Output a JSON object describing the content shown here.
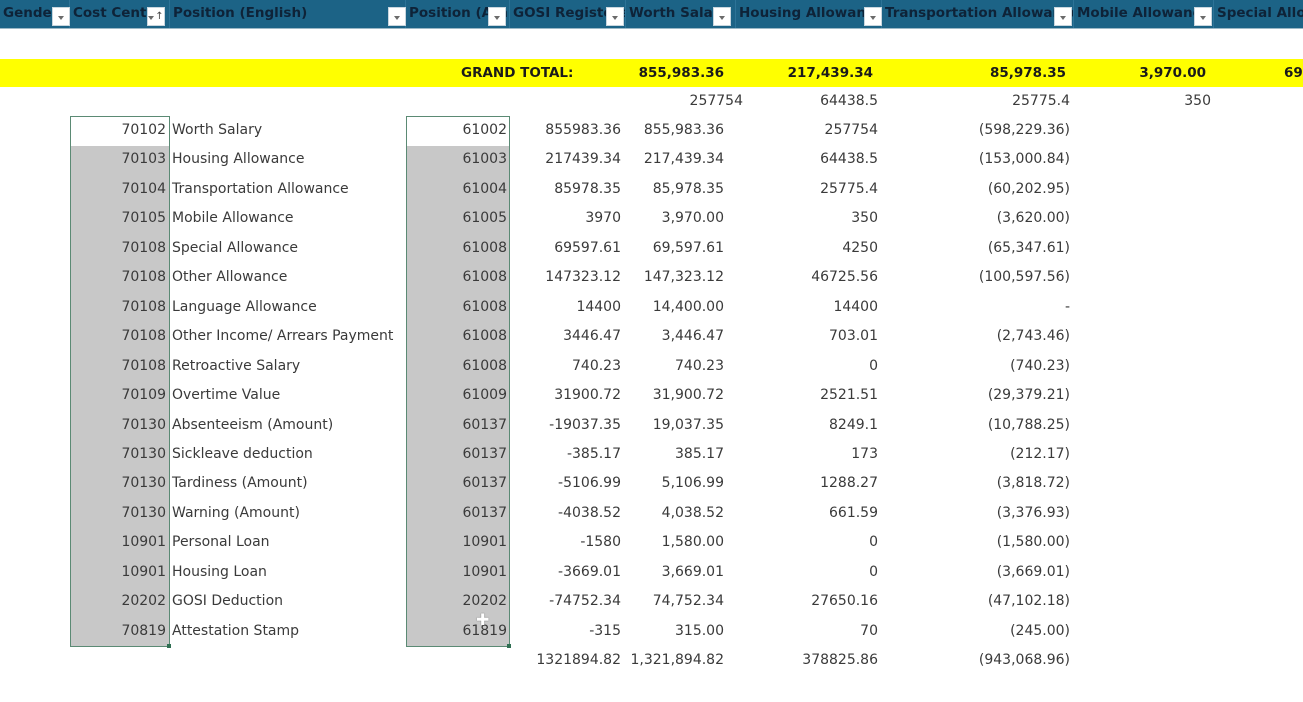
{
  "header": {
    "columns": [
      {
        "label": "Gender",
        "filter": "dropdown"
      },
      {
        "label": "Cost Center",
        "filter": "sorted-ascending"
      },
      {
        "label": "Position (English)",
        "filter": "dropdown"
      },
      {
        "label": "Position (Arabic)",
        "filter": "dropdown"
      },
      {
        "label": "GOSI Registered",
        "filter": "dropdown"
      },
      {
        "label": "Worth Salary",
        "filter": "dropdown"
      },
      {
        "label": "Housing Allowance",
        "filter": "dropdown"
      },
      {
        "label": "Transportation Allowance",
        "filter": "dropdown"
      },
      {
        "label": "Mobile Allowance",
        "filter": "dropdown"
      },
      {
        "label": "Special Allowance",
        "filter": "dropdown"
      }
    ]
  },
  "grand_total": {
    "label": "GRAND TOTAL:",
    "worth_salary": "855,983.36",
    "housing_allowance": "217,439.34",
    "transportation_allowance": "85,978.35",
    "mobile_allowance": "3,970.00",
    "special_allowance_partial": "69"
  },
  "subtotals": {
    "worth_salary": "257754",
    "housing_allowance": "64438.5",
    "transportation_allowance": "25775.4",
    "mobile_allowance": "350"
  },
  "rows": [
    {
      "code": "70102",
      "name": "Worth Salary",
      "account": "61002",
      "raw": "855983.36",
      "amount": "855,983.36",
      "gosi": "257754",
      "diff": "(598,229.36)"
    },
    {
      "code": "70103",
      "name": "Housing Allowance",
      "account": "61003",
      "raw": "217439.34",
      "amount": "217,439.34",
      "gosi": "64438.5",
      "diff": "(153,000.84)"
    },
    {
      "code": "70104",
      "name": "Transportation Allowance",
      "account": "61004",
      "raw": "85978.35",
      "amount": "85,978.35",
      "gosi": "25775.4",
      "diff": "(60,202.95)"
    },
    {
      "code": "70105",
      "name": "Mobile Allowance",
      "account": "61005",
      "raw": "3970",
      "amount": "3,970.00",
      "gosi": "350",
      "diff": "(3,620.00)"
    },
    {
      "code": "70108",
      "name": "Special Allowance",
      "account": "61008",
      "raw": "69597.61",
      "amount": "69,597.61",
      "gosi": "4250",
      "diff": "(65,347.61)"
    },
    {
      "code": "70108",
      "name": "Other Allowance",
      "account": "61008",
      "raw": "147323.12",
      "amount": "147,323.12",
      "gosi": "46725.56",
      "diff": "(100,597.56)"
    },
    {
      "code": "70108",
      "name": "Language Allowance",
      "account": "61008",
      "raw": "14400",
      "amount": "14,400.00",
      "gosi": "14400",
      "diff": "-"
    },
    {
      "code": "70108",
      "name": "Other Income/ Arrears Payment",
      "account": "61008",
      "raw": "3446.47",
      "amount": "3,446.47",
      "gosi": "703.01",
      "diff": "(2,743.46)"
    },
    {
      "code": "70108",
      "name": "Retroactive Salary",
      "account": "61008",
      "raw": "740.23",
      "amount": "740.23",
      "gosi": "0",
      "diff": "(740.23)"
    },
    {
      "code": "70109",
      "name": "Overtime Value",
      "account": "61009",
      "raw": "31900.72",
      "amount": "31,900.72",
      "gosi": "2521.51",
      "diff": "(29,379.21)"
    },
    {
      "code": "70130",
      "name": "Absenteeism (Amount)",
      "account": "60137",
      "raw": "-19037.35",
      "amount": "19,037.35",
      "gosi": "8249.1",
      "diff": "(10,788.25)"
    },
    {
      "code": "70130",
      "name": "Sickleave deduction",
      "account": "60137",
      "raw": "-385.17",
      "amount": "385.17",
      "gosi": "173",
      "diff": "(212.17)"
    },
    {
      "code": "70130",
      "name": "Tardiness (Amount)",
      "account": "60137",
      "raw": "-5106.99",
      "amount": "5,106.99",
      "gosi": "1288.27",
      "diff": "(3,818.72)"
    },
    {
      "code": "70130",
      "name": "Warning (Amount)",
      "account": "60137",
      "raw": "-4038.52",
      "amount": "4,038.52",
      "gosi": "661.59",
      "diff": "(3,376.93)"
    },
    {
      "code": "10901",
      "name": "Personal Loan",
      "account": "10901",
      "raw": "-1580",
      "amount": "1,580.00",
      "gosi": "0",
      "diff": "(1,580.00)"
    },
    {
      "code": "10901",
      "name": "Housing Loan",
      "account": "10901",
      "raw": "-3669.01",
      "amount": "3,669.01",
      "gosi": "0",
      "diff": "(3,669.01)"
    },
    {
      "code": "20202",
      "name": "GOSI Deduction",
      "account": "20202",
      "raw": "-74752.34",
      "amount": "74,752.34",
      "gosi": "27650.16",
      "diff": "(47,102.18)"
    },
    {
      "code": "70819",
      "name": "Attestation Stamp",
      "account": "61819",
      "raw": "-315",
      "amount": "315.00",
      "gosi": "70",
      "diff": "(245.00)"
    }
  ],
  "totals_row": {
    "raw": "1321894.82",
    "amount": "1,321,894.82",
    "gosi": "378825.86",
    "diff": "(943,068.96)"
  },
  "colors": {
    "header_bg": "#1c6386",
    "header_text": "#0e2338",
    "grand_total_bg": "#ffff00",
    "selection_fill": "#c8c8c8",
    "selection_border": "#5b8a74"
  }
}
